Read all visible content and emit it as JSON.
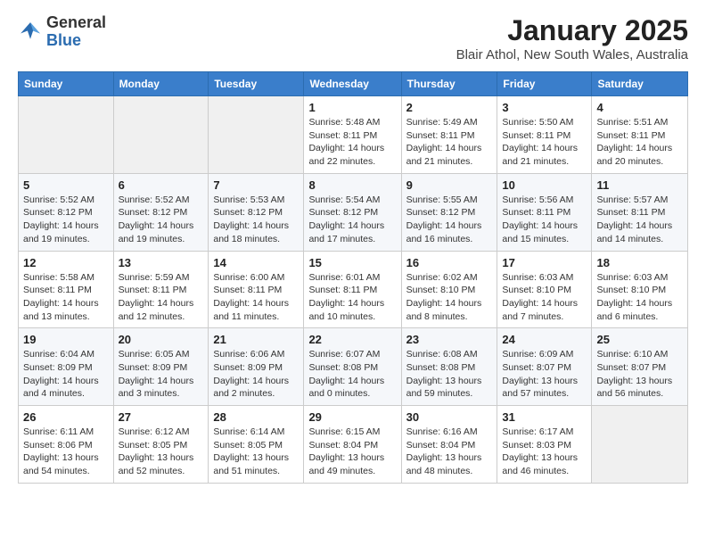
{
  "header": {
    "logo_general": "General",
    "logo_blue": "Blue",
    "title": "January 2025",
    "subtitle": "Blair Athol, New South Wales, Australia"
  },
  "days_of_week": [
    "Sunday",
    "Monday",
    "Tuesday",
    "Wednesday",
    "Thursday",
    "Friday",
    "Saturday"
  ],
  "weeks": [
    [
      {
        "num": "",
        "info": ""
      },
      {
        "num": "",
        "info": ""
      },
      {
        "num": "",
        "info": ""
      },
      {
        "num": "1",
        "info": "Sunrise: 5:48 AM\nSunset: 8:11 PM\nDaylight: 14 hours\nand 22 minutes."
      },
      {
        "num": "2",
        "info": "Sunrise: 5:49 AM\nSunset: 8:11 PM\nDaylight: 14 hours\nand 21 minutes."
      },
      {
        "num": "3",
        "info": "Sunrise: 5:50 AM\nSunset: 8:11 PM\nDaylight: 14 hours\nand 21 minutes."
      },
      {
        "num": "4",
        "info": "Sunrise: 5:51 AM\nSunset: 8:11 PM\nDaylight: 14 hours\nand 20 minutes."
      }
    ],
    [
      {
        "num": "5",
        "info": "Sunrise: 5:52 AM\nSunset: 8:12 PM\nDaylight: 14 hours\nand 19 minutes."
      },
      {
        "num": "6",
        "info": "Sunrise: 5:52 AM\nSunset: 8:12 PM\nDaylight: 14 hours\nand 19 minutes."
      },
      {
        "num": "7",
        "info": "Sunrise: 5:53 AM\nSunset: 8:12 PM\nDaylight: 14 hours\nand 18 minutes."
      },
      {
        "num": "8",
        "info": "Sunrise: 5:54 AM\nSunset: 8:12 PM\nDaylight: 14 hours\nand 17 minutes."
      },
      {
        "num": "9",
        "info": "Sunrise: 5:55 AM\nSunset: 8:12 PM\nDaylight: 14 hours\nand 16 minutes."
      },
      {
        "num": "10",
        "info": "Sunrise: 5:56 AM\nSunset: 8:11 PM\nDaylight: 14 hours\nand 15 minutes."
      },
      {
        "num": "11",
        "info": "Sunrise: 5:57 AM\nSunset: 8:11 PM\nDaylight: 14 hours\nand 14 minutes."
      }
    ],
    [
      {
        "num": "12",
        "info": "Sunrise: 5:58 AM\nSunset: 8:11 PM\nDaylight: 14 hours\nand 13 minutes."
      },
      {
        "num": "13",
        "info": "Sunrise: 5:59 AM\nSunset: 8:11 PM\nDaylight: 14 hours\nand 12 minutes."
      },
      {
        "num": "14",
        "info": "Sunrise: 6:00 AM\nSunset: 8:11 PM\nDaylight: 14 hours\nand 11 minutes."
      },
      {
        "num": "15",
        "info": "Sunrise: 6:01 AM\nSunset: 8:11 PM\nDaylight: 14 hours\nand 10 minutes."
      },
      {
        "num": "16",
        "info": "Sunrise: 6:02 AM\nSunset: 8:10 PM\nDaylight: 14 hours\nand 8 minutes."
      },
      {
        "num": "17",
        "info": "Sunrise: 6:03 AM\nSunset: 8:10 PM\nDaylight: 14 hours\nand 7 minutes."
      },
      {
        "num": "18",
        "info": "Sunrise: 6:03 AM\nSunset: 8:10 PM\nDaylight: 14 hours\nand 6 minutes."
      }
    ],
    [
      {
        "num": "19",
        "info": "Sunrise: 6:04 AM\nSunset: 8:09 PM\nDaylight: 14 hours\nand 4 minutes."
      },
      {
        "num": "20",
        "info": "Sunrise: 6:05 AM\nSunset: 8:09 PM\nDaylight: 14 hours\nand 3 minutes."
      },
      {
        "num": "21",
        "info": "Sunrise: 6:06 AM\nSunset: 8:09 PM\nDaylight: 14 hours\nand 2 minutes."
      },
      {
        "num": "22",
        "info": "Sunrise: 6:07 AM\nSunset: 8:08 PM\nDaylight: 14 hours\nand 0 minutes."
      },
      {
        "num": "23",
        "info": "Sunrise: 6:08 AM\nSunset: 8:08 PM\nDaylight: 13 hours\nand 59 minutes."
      },
      {
        "num": "24",
        "info": "Sunrise: 6:09 AM\nSunset: 8:07 PM\nDaylight: 13 hours\nand 57 minutes."
      },
      {
        "num": "25",
        "info": "Sunrise: 6:10 AM\nSunset: 8:07 PM\nDaylight: 13 hours\nand 56 minutes."
      }
    ],
    [
      {
        "num": "26",
        "info": "Sunrise: 6:11 AM\nSunset: 8:06 PM\nDaylight: 13 hours\nand 54 minutes."
      },
      {
        "num": "27",
        "info": "Sunrise: 6:12 AM\nSunset: 8:05 PM\nDaylight: 13 hours\nand 52 minutes."
      },
      {
        "num": "28",
        "info": "Sunrise: 6:14 AM\nSunset: 8:05 PM\nDaylight: 13 hours\nand 51 minutes."
      },
      {
        "num": "29",
        "info": "Sunrise: 6:15 AM\nSunset: 8:04 PM\nDaylight: 13 hours\nand 49 minutes."
      },
      {
        "num": "30",
        "info": "Sunrise: 6:16 AM\nSunset: 8:04 PM\nDaylight: 13 hours\nand 48 minutes."
      },
      {
        "num": "31",
        "info": "Sunrise: 6:17 AM\nSunset: 8:03 PM\nDaylight: 13 hours\nand 46 minutes."
      },
      {
        "num": "",
        "info": ""
      }
    ]
  ]
}
